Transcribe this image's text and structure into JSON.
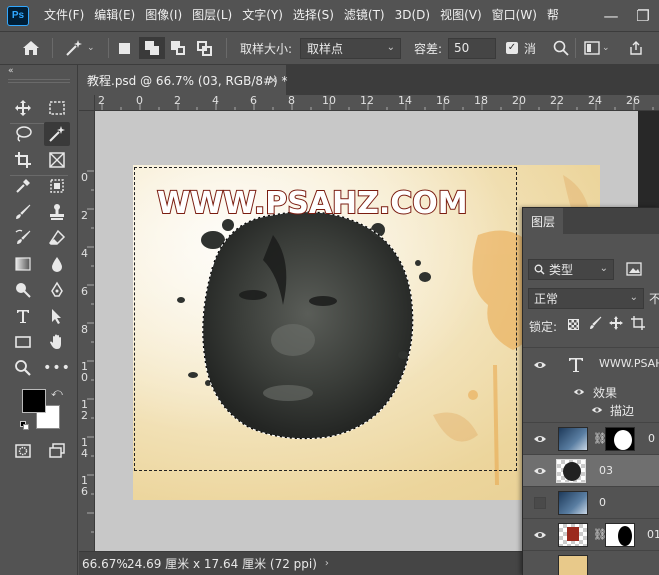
{
  "app": {
    "logo": "Ps"
  },
  "menu": [
    "文件(F)",
    "编辑(E)",
    "图像(I)",
    "图层(L)",
    "文字(Y)",
    "选择(S)",
    "滤镜(T)",
    "3D(D)",
    "视图(V)",
    "窗口(W)",
    "帮"
  ],
  "window_controls": {
    "minimize": "—",
    "restore": "❐"
  },
  "options": {
    "sample_size_label": "取样大小:",
    "sample_size_value": "取样点",
    "tolerance_label": "容差:",
    "tolerance_value": "50",
    "antialias_label": "消",
    "antialias_checked": true
  },
  "toolbar": {
    "collapse": "«",
    "foreground_color": "#000000",
    "background_color": "#ffffff"
  },
  "document": {
    "tab_title": "教程.psd @ 66.7% (03, RGB/8#) *",
    "close_glyph": "✕",
    "watermark_text": "WWW.PSAHZ.COM"
  },
  "ruler": {
    "top_labels": [
      "2",
      "0",
      "2",
      "4",
      "6",
      "8",
      "10",
      "12",
      "14",
      "16",
      "18",
      "20",
      "22",
      "24",
      "26",
      "28"
    ],
    "left_labels": [
      "0",
      "2",
      "4",
      "6",
      "8",
      "1 0",
      "1 2",
      "1 4",
      "1 6"
    ]
  },
  "status": {
    "zoom": "66.67%",
    "doc_size": "24.69 厘米 x 17.64 厘米 (72 ppi)",
    "arrow": "›"
  },
  "layers_panel": {
    "tab_label": "图层",
    "filter_kind": "类型",
    "blend_mode": "正常",
    "blend_more": "不",
    "lock_label": "锁定:",
    "layers": [
      {
        "name": "WWW.PSAH",
        "type": "text",
        "visible": true
      },
      {
        "name": "效果",
        "type": "effects",
        "visible": true
      },
      {
        "name": "描边",
        "type": "effect-item",
        "visible": true
      },
      {
        "name": "0",
        "type": "masked",
        "visible": true
      },
      {
        "name": "03",
        "type": "pixel",
        "visible": true,
        "selected": true
      },
      {
        "name": "0",
        "type": "pixel",
        "visible": false
      },
      {
        "name": "01",
        "type": "masked",
        "visible": true
      }
    ]
  }
}
